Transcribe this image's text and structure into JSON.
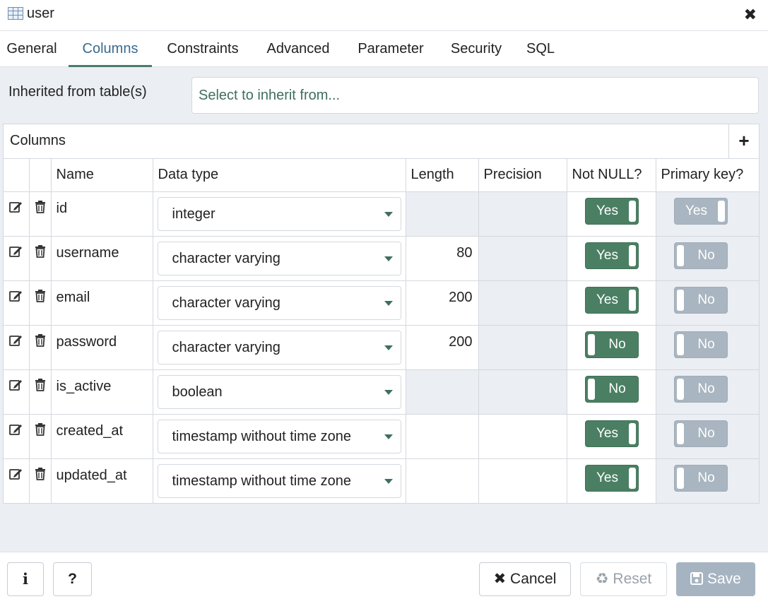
{
  "dialog": {
    "title": "user",
    "close_glyph": "✖"
  },
  "tabs": [
    {
      "label": "General"
    },
    {
      "label": "Columns"
    },
    {
      "label": "Constraints"
    },
    {
      "label": "Advanced"
    },
    {
      "label": "Parameter"
    },
    {
      "label": "Security"
    },
    {
      "label": "SQL"
    }
  ],
  "active_tab": "Columns",
  "inherit": {
    "label": "Inherited from table(s)",
    "placeholder": "Select to inherit from..."
  },
  "columns_grid": {
    "title": "Columns",
    "add_glyph": "+",
    "headers": {
      "name": "Name",
      "data_type": "Data type",
      "length": "Length",
      "precision": "Precision",
      "not_null": "Not NULL?",
      "primary_key": "Primary key?"
    },
    "rows": [
      {
        "name": "id",
        "data_type": "integer",
        "length": "",
        "precision": "",
        "not_null": "Yes",
        "primary_key": "Yes"
      },
      {
        "name": "username",
        "data_type": "character varying",
        "length": "80",
        "precision": "",
        "not_null": "Yes",
        "primary_key": "No"
      },
      {
        "name": "email",
        "data_type": "character varying",
        "length": "200",
        "precision": "",
        "not_null": "Yes",
        "primary_key": "No"
      },
      {
        "name": "password",
        "data_type": "character varying",
        "length": "200",
        "precision": "",
        "not_null": "No",
        "primary_key": "No"
      },
      {
        "name": "is_active",
        "data_type": "boolean",
        "length": "",
        "precision": "",
        "not_null": "No",
        "primary_key": "No"
      },
      {
        "name": "created_at",
        "data_type": "timestamp without time zone",
        "length": "",
        "precision": "",
        "not_null": "Yes",
        "primary_key": "No"
      },
      {
        "name": "updated_at",
        "data_type": "timestamp without time zone",
        "length": "",
        "precision": "",
        "not_null": "Yes",
        "primary_key": "No"
      }
    ]
  },
  "footer": {
    "info_label": "i",
    "help_label": "?",
    "cancel_label": "Cancel",
    "reset_label": "Reset",
    "save_label": "Save"
  },
  "colors": {
    "accent": "#4b7f63",
    "disabled_toggle": "#a9b5c0",
    "panel_bg": "#ebeef3"
  }
}
